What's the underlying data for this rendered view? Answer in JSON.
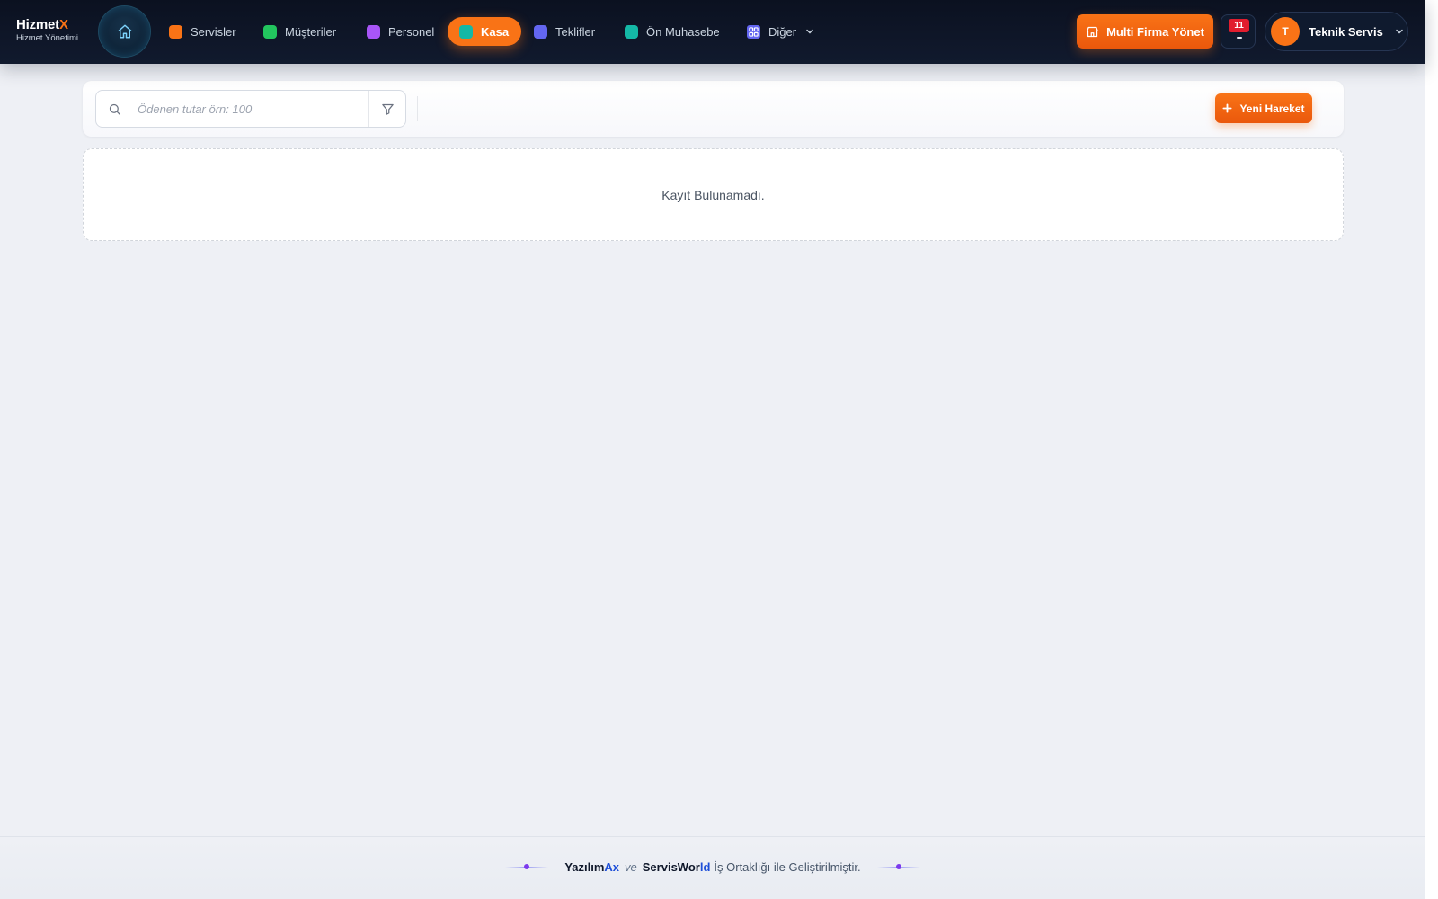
{
  "brand": {
    "name_main": "Hizmet",
    "name_accent": "X",
    "subtitle": "Hizmet Yönetimi"
  },
  "nav": {
    "home_icon": "home-icon",
    "items": [
      {
        "label": "Servisler",
        "color": "#f97316"
      },
      {
        "label": "Müşteriler",
        "color": "#22c55e"
      },
      {
        "label": "Personel",
        "color": "#a855f7"
      },
      {
        "label": "Kasa",
        "color": "#14b8a6",
        "active": true
      },
      {
        "label": "Teklifler",
        "color": "#6366f1"
      },
      {
        "label": "Ön Muhasebe",
        "color": "#14b8a6"
      },
      {
        "label": "Diğer",
        "color": "#6366f1"
      }
    ]
  },
  "header_actions": {
    "multi_firm_label": "Multi Firma Yönet",
    "notification_count": "11",
    "user_initial": "T",
    "user_name": "Teknik Servis"
  },
  "toolbar": {
    "search_placeholder": "Ödenen tutar örn: 100",
    "search_value": "",
    "new_button_label": "Yeni Hareket"
  },
  "empty_state": {
    "message": "Kayıt Bulunamadı."
  },
  "footer": {
    "partner1_main": "Yazılım",
    "partner1_accent": "Ax",
    "connector": "ve",
    "partner2_main": "ServisWor",
    "partner2_accent": "ld",
    "suffix": "İş Ortaklığı ile Geliştirilmiştir."
  },
  "colors": {
    "accent": "#f97316",
    "navbar_bg": "#0b1120",
    "page_bg": "#eef0f5",
    "notification_badge": "#e11d2e"
  }
}
